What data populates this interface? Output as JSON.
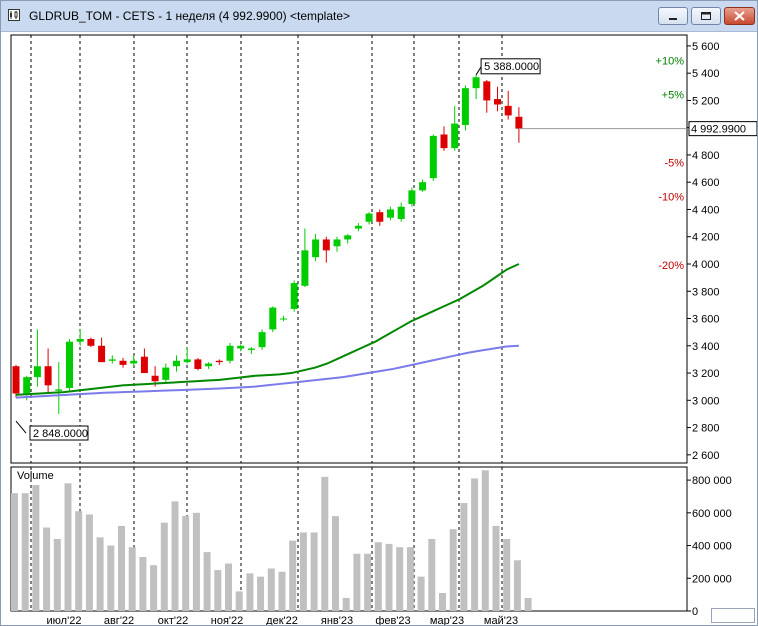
{
  "window": {
    "title": "GLDRUB_TOM - CETS - 1 неделя (4 992.9900) <template>"
  },
  "colors": {
    "up_candle": "#00cc00",
    "down_candle": "#dd0000",
    "ma_fast": "#008800",
    "ma_slow": "#7b7bea",
    "volume_bar": "#c0c0c0",
    "pos_pct": "#008000",
    "neg_pct": "#c00000"
  },
  "chart_data": [
    {
      "type": "candlestick",
      "symbol": "GLDRUB_TOM",
      "x_tick_labels": [
        "июл'22",
        "авг'22",
        "окт'22",
        "ноя'22",
        "дек'22",
        "янв'23",
        "фев'23",
        "мар'23",
        "май'23"
      ],
      "y_ticks": [
        2600,
        2800,
        3000,
        3200,
        3400,
        3600,
        3800,
        4000,
        4200,
        4400,
        4600,
        4800,
        5000,
        5200,
        5400,
        5600
      ],
      "y_tick_labels": [
        "2 600",
        "2 800",
        "3 000",
        "3 200",
        "3 400",
        "3 600",
        "3 800",
        "4 000",
        "4 200",
        "4 400",
        "4 600",
        "4 800",
        "5 000",
        "5 200",
        "5 400",
        "5 600"
      ],
      "ylim": [
        2540,
        5680
      ],
      "last_price": 4992.99,
      "last_price_label": "4 992.9900",
      "max_label": "5 388.0000",
      "min_label": "2 848.0000",
      "max_value": 5388,
      "min_value": 2848,
      "pct_levels": [
        {
          "label": "+10%",
          "value": 5492.29
        },
        {
          "label": "+5%",
          "value": 5242.64
        },
        {
          "label": "-5%",
          "value": 4743.34
        },
        {
          "label": "-10%",
          "value": 4493.69
        },
        {
          "label": "-20%",
          "value": 3994.39
        }
      ],
      "candles": [
        [
          3250,
          3260,
          3020,
          3050
        ],
        [
          3040,
          3180,
          3000,
          3170
        ],
        [
          3170,
          3520,
          3100,
          3250
        ],
        [
          3250,
          3380,
          3050,
          3110
        ],
        [
          3070,
          3280,
          2900,
          3080
        ],
        [
          3090,
          3450,
          3060,
          3430
        ],
        [
          3430,
          3520,
          3400,
          3450
        ],
        [
          3450,
          3460,
          3390,
          3400
        ],
        [
          3400,
          3460,
          3280,
          3280
        ],
        [
          3290,
          3330,
          3270,
          3300
        ],
        [
          3290,
          3310,
          3240,
          3260
        ],
        [
          3270,
          3330,
          3250,
          3290
        ],
        [
          3320,
          3380,
          3200,
          3200
        ],
        [
          3180,
          3250,
          3100,
          3140
        ],
        [
          3150,
          3270,
          3120,
          3240
        ],
        [
          3250,
          3330,
          3210,
          3290
        ],
        [
          3280,
          3390,
          3270,
          3300
        ],
        [
          3300,
          3310,
          3220,
          3230
        ],
        [
          3250,
          3280,
          3230,
          3270
        ],
        [
          3290,
          3300,
          3260,
          3280
        ],
        [
          3290,
          3420,
          3270,
          3400
        ],
        [
          3380,
          3410,
          3360,
          3400
        ],
        [
          3370,
          3390,
          3340,
          3380
        ],
        [
          3390,
          3520,
          3370,
          3500
        ],
        [
          3520,
          3690,
          3500,
          3680
        ],
        [
          3600,
          3620,
          3580,
          3600
        ],
        [
          3670,
          3880,
          3650,
          3860
        ],
        [
          3840,
          4260,
          3830,
          4100
        ],
        [
          4050,
          4220,
          4020,
          4180
        ],
        [
          4180,
          4200,
          4010,
          4100
        ],
        [
          4130,
          4200,
          4090,
          4180
        ],
        [
          4180,
          4220,
          4150,
          4210
        ],
        [
          4260,
          4300,
          4240,
          4280
        ],
        [
          4310,
          4380,
          4290,
          4370
        ],
        [
          4380,
          4400,
          4280,
          4310
        ],
        [
          4340,
          4420,
          4320,
          4400
        ],
        [
          4330,
          4450,
          4310,
          4420
        ],
        [
          4440,
          4560,
          4420,
          4540
        ],
        [
          4540,
          4620,
          4530,
          4600
        ],
        [
          4630,
          4950,
          4610,
          4940
        ],
        [
          4950,
          5010,
          4830,
          4850
        ],
        [
          4850,
          5160,
          4830,
          5030
        ],
        [
          5020,
          5310,
          4980,
          5290
        ],
        [
          5290,
          5388,
          5210,
          5370
        ],
        [
          5340,
          5350,
          5110,
          5200
        ],
        [
          5210,
          5300,
          5120,
          5170
        ],
        [
          5160,
          5270,
          5060,
          5090
        ],
        [
          5080,
          5150,
          4890,
          4993
        ]
      ],
      "ma_fast": [
        3040,
        3045,
        3050,
        3055,
        3060,
        3070,
        3080,
        3090,
        3100,
        3110,
        3115,
        3120,
        3125,
        3130,
        3135,
        3140,
        3145,
        3150,
        3160,
        3170,
        3180,
        3185,
        3190,
        3200,
        3220,
        3240,
        3270,
        3310,
        3350,
        3390,
        3430,
        3480,
        3530,
        3580,
        3620,
        3660,
        3700,
        3740,
        3790,
        3840,
        3900,
        3960,
        4000
      ],
      "ma_fast_start_index": 0,
      "ma_slow": [
        3020,
        3025,
        3030,
        3035,
        3040,
        3045,
        3050,
        3055,
        3058,
        3062,
        3065,
        3068,
        3072,
        3075,
        3078,
        3082,
        3086,
        3090,
        3095,
        3100,
        3110,
        3120,
        3130,
        3140,
        3150,
        3160,
        3170,
        3185,
        3200,
        3215,
        3230,
        3250,
        3270,
        3290,
        3310,
        3330,
        3350,
        3365,
        3380,
        3395,
        3400
      ]
    },
    {
      "type": "bar",
      "title": "Volume",
      "y_ticks": [
        0,
        200000,
        400000,
        600000,
        800000
      ],
      "y_tick_labels": [
        "0",
        "200 000",
        "400 000",
        "600 000",
        "800 000"
      ],
      "ylim": [
        0,
        880000
      ],
      "values": [
        720000,
        720000,
        770000,
        510000,
        440000,
        780000,
        610000,
        590000,
        450000,
        400000,
        520000,
        390000,
        330000,
        280000,
        540000,
        670000,
        580000,
        600000,
        360000,
        250000,
        290000,
        120000,
        230000,
        210000,
        260000,
        240000,
        430000,
        480000,
        480000,
        820000,
        580000,
        80000,
        350000,
        350000,
        420000,
        410000,
        390000,
        390000,
        210000,
        440000,
        110000,
        500000,
        660000,
        810000,
        860000,
        520000,
        440000,
        310000,
        80000
      ]
    }
  ]
}
